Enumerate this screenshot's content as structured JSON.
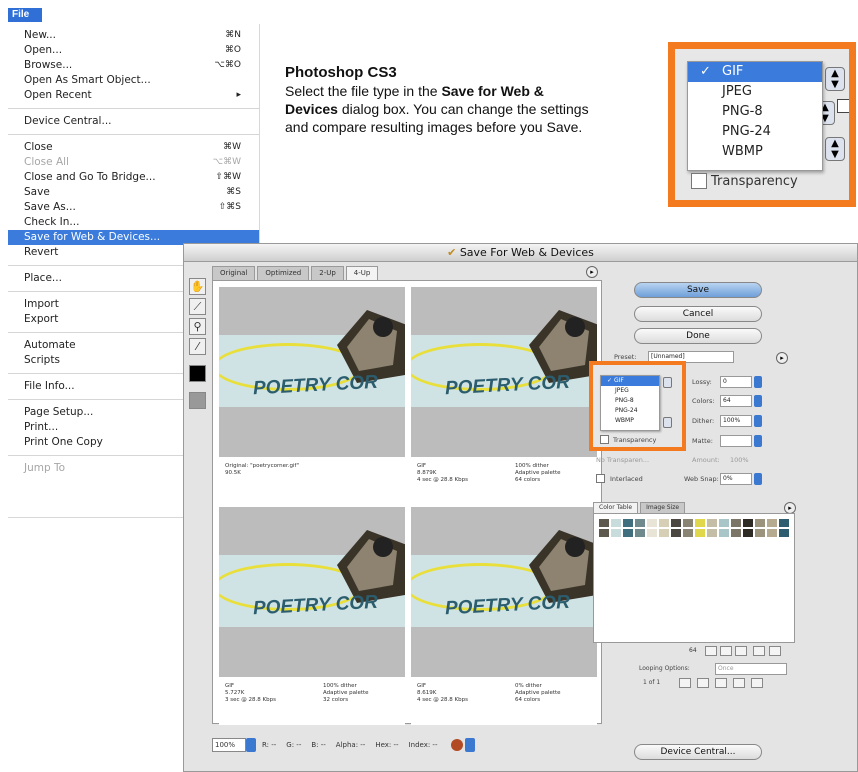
{
  "file_menu": {
    "title": "File",
    "items": [
      {
        "label": "New...",
        "shortcut": "⌘N"
      },
      {
        "label": "Open...",
        "shortcut": "⌘O"
      },
      {
        "label": "Browse...",
        "shortcut": "⌥⌘O"
      },
      {
        "label": "Open As Smart Object...",
        "shortcut": ""
      },
      {
        "label": "Open Recent",
        "shortcut": "▸"
      },
      {
        "label": "Device Central...",
        "shortcut": ""
      },
      {
        "label": "Close",
        "shortcut": "⌘W"
      },
      {
        "label": "Close All",
        "shortcut": "⌥⌘W"
      },
      {
        "label": "Close and Go To Bridge...",
        "shortcut": "⇧⌘W"
      },
      {
        "label": "Save",
        "shortcut": "⌘S"
      },
      {
        "label": "Save As...",
        "shortcut": "⇧⌘S"
      },
      {
        "label": "Check In...",
        "shortcut": ""
      },
      {
        "label": "Save for Web & Devices...",
        "shortcut": ""
      },
      {
        "label": "Revert",
        "shortcut": ""
      },
      {
        "label": "Place...",
        "shortcut": ""
      },
      {
        "label": "Import",
        "shortcut": ""
      },
      {
        "label": "Export",
        "shortcut": ""
      },
      {
        "label": "Automate",
        "shortcut": ""
      },
      {
        "label": "Scripts",
        "shortcut": ""
      },
      {
        "label": "File Info...",
        "shortcut": ""
      },
      {
        "label": "Page Setup...",
        "shortcut": ""
      },
      {
        "label": "Print...",
        "shortcut": ""
      },
      {
        "label": "Print One Copy",
        "shortcut": ""
      },
      {
        "label": "Jump To",
        "shortcut": ""
      }
    ]
  },
  "info": {
    "title": "Photoshop CS3",
    "line1_pre": "Select the file type in the ",
    "line1_bold": "Save for Web &",
    "line2_bold": "Devices",
    "line2_post": " dialog box. You can change the settings",
    "line3": "and compare resulting images before you Save."
  },
  "zoom_callout": {
    "options": [
      "GIF",
      "JPEG",
      "PNG-8",
      "PNG-24",
      "WBMP"
    ],
    "selected": "GIF",
    "checkmark": "✓",
    "transparency_label": "Transparency",
    "accent": "#f47a20"
  },
  "dialog": {
    "title": "Save For Web & Devices",
    "tabs": [
      "Original",
      "Optimized",
      "2-Up",
      "4-Up"
    ],
    "active_tab": "4-Up",
    "image_word": "POETRY COR",
    "panes": [
      {
        "left": "Original: \"poetrycorner.gif\"\n90.5K",
        "right": ""
      },
      {
        "left": "GIF\n8.879K\n4 sec @ 28.8 Kbps",
        "right": "100% dither\nAdaptive palette\n64 colors"
      },
      {
        "left": "GIF\n5.727K\n3 sec @ 28.8 Kbps",
        "right": "100% dither\nAdaptive palette\n32 colors"
      },
      {
        "left": "GIF\n8.619K\n4 sec @ 28.8 Kbps",
        "right": "0% dither\nAdaptive palette\n64 colors"
      }
    ],
    "buttons": {
      "save": "Save",
      "cancel": "Cancel",
      "done": "Done",
      "device_central": "Device Central..."
    },
    "preset_label": "Preset:",
    "preset_value": "[Unnamed]",
    "lossy_label": "Lossy:",
    "lossy_value": "0",
    "colors_label": "Colors:",
    "colors_value": "64",
    "dither_label": "Dither:",
    "dither_value": "100%",
    "matte_label": "Matte:",
    "amount_label": "Amount:",
    "amount_value": "100%",
    "no_transparency": "No Transparen...",
    "interlaced_label": "Interlaced",
    "websnap_label": "Web Snap:",
    "websnap_value": "0%",
    "transparency_label": "Transparency",
    "format_options": [
      "GIF",
      "JPEG",
      "PNG-8",
      "PNG-24",
      "WBMP"
    ],
    "color_table_tab": "Color Table",
    "image_size_tab": "Image Size",
    "color_count": "64",
    "looping_label": "Looping Options:",
    "looping_value": "Once",
    "frame_counter": "1 of 1",
    "zoom_value": "100%",
    "status": {
      "r": "R: --",
      "g": "G: --",
      "b": "B: --",
      "alpha": "Alpha: --",
      "hex": "Hex: --",
      "index": "Index: --"
    }
  }
}
